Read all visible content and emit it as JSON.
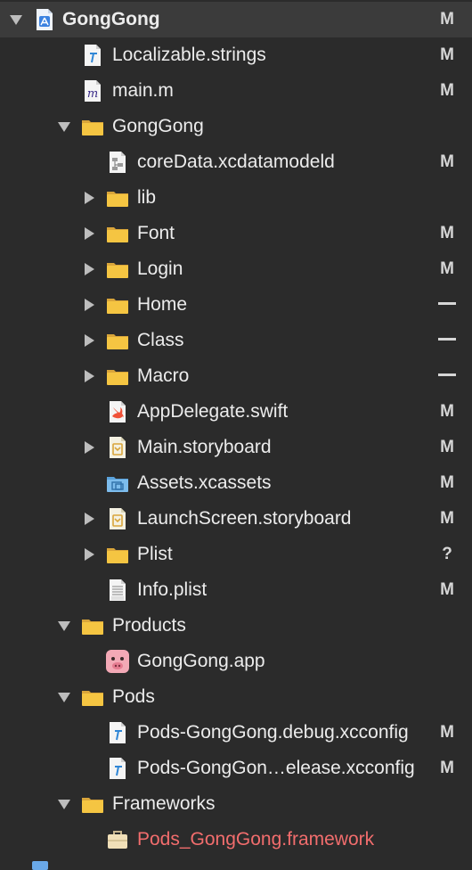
{
  "navigator": {
    "rows": [
      {
        "label": "GongGong",
        "status": "M",
        "icon": "xcode-project-icon",
        "disclosure": "expanded",
        "selected": true,
        "bold": true
      },
      {
        "label": "Localizable.strings",
        "status": "M",
        "icon": "strings-file-icon"
      },
      {
        "label": "main.m",
        "status": "M",
        "icon": "objc-source-file-icon"
      },
      {
        "label": "GongGong",
        "status": "",
        "icon": "folder-icon",
        "disclosure": "expanded"
      },
      {
        "label": "coreData.xcdatamodeld",
        "status": "M",
        "icon": "coredata-model-icon"
      },
      {
        "label": "lib",
        "status": "",
        "icon": "folder-icon",
        "disclosure": "collapsed"
      },
      {
        "label": "Font",
        "status": "M",
        "icon": "folder-icon",
        "disclosure": "collapsed"
      },
      {
        "label": "Login",
        "status": "M",
        "icon": "folder-icon",
        "disclosure": "collapsed"
      },
      {
        "label": "Home",
        "status": "—",
        "icon": "folder-icon",
        "disclosure": "collapsed"
      },
      {
        "label": "Class",
        "status": "—",
        "icon": "folder-icon",
        "disclosure": "collapsed"
      },
      {
        "label": "Macro",
        "status": "—",
        "icon": "folder-icon",
        "disclosure": "collapsed"
      },
      {
        "label": "AppDelegate.swift",
        "status": "M",
        "icon": "swift-file-icon"
      },
      {
        "label": "Main.storyboard",
        "status": "M",
        "icon": "storyboard-icon",
        "disclosure": "collapsed"
      },
      {
        "label": "Assets.xcassets",
        "status": "M",
        "icon": "asset-catalog-icon"
      },
      {
        "label": "LaunchScreen.storyboard",
        "status": "M",
        "icon": "storyboard-icon",
        "disclosure": "collapsed"
      },
      {
        "label": "Plist",
        "status": "?",
        "icon": "folder-icon",
        "disclosure": "collapsed"
      },
      {
        "label": "Info.plist",
        "status": "M",
        "icon": "plist-file-icon"
      },
      {
        "label": "Products",
        "status": "",
        "icon": "folder-icon",
        "disclosure": "expanded"
      },
      {
        "label": "GongGong.app",
        "status": "",
        "icon": "app-pig-icon"
      },
      {
        "label": "Pods",
        "status": "",
        "icon": "folder-icon",
        "disclosure": "expanded"
      },
      {
        "label": "Pods-GongGong.debug.xcconfig",
        "status": "M",
        "icon": "xcconfig-file-icon"
      },
      {
        "label": "Pods-GongGon…elease.xcconfig",
        "status": "M",
        "icon": "xcconfig-file-icon"
      },
      {
        "label": "Frameworks",
        "status": "",
        "icon": "folder-icon",
        "disclosure": "expanded"
      },
      {
        "label": "Pods_GongGong.framework",
        "status": "",
        "icon": "framework-toolbox-icon",
        "missing": true
      }
    ]
  },
  "colors": {
    "background": "#2b2b2b",
    "selected_row": "#3b3b3b",
    "missing_file_text": "#f26d6d",
    "folder_yellow": "#f5c542"
  }
}
